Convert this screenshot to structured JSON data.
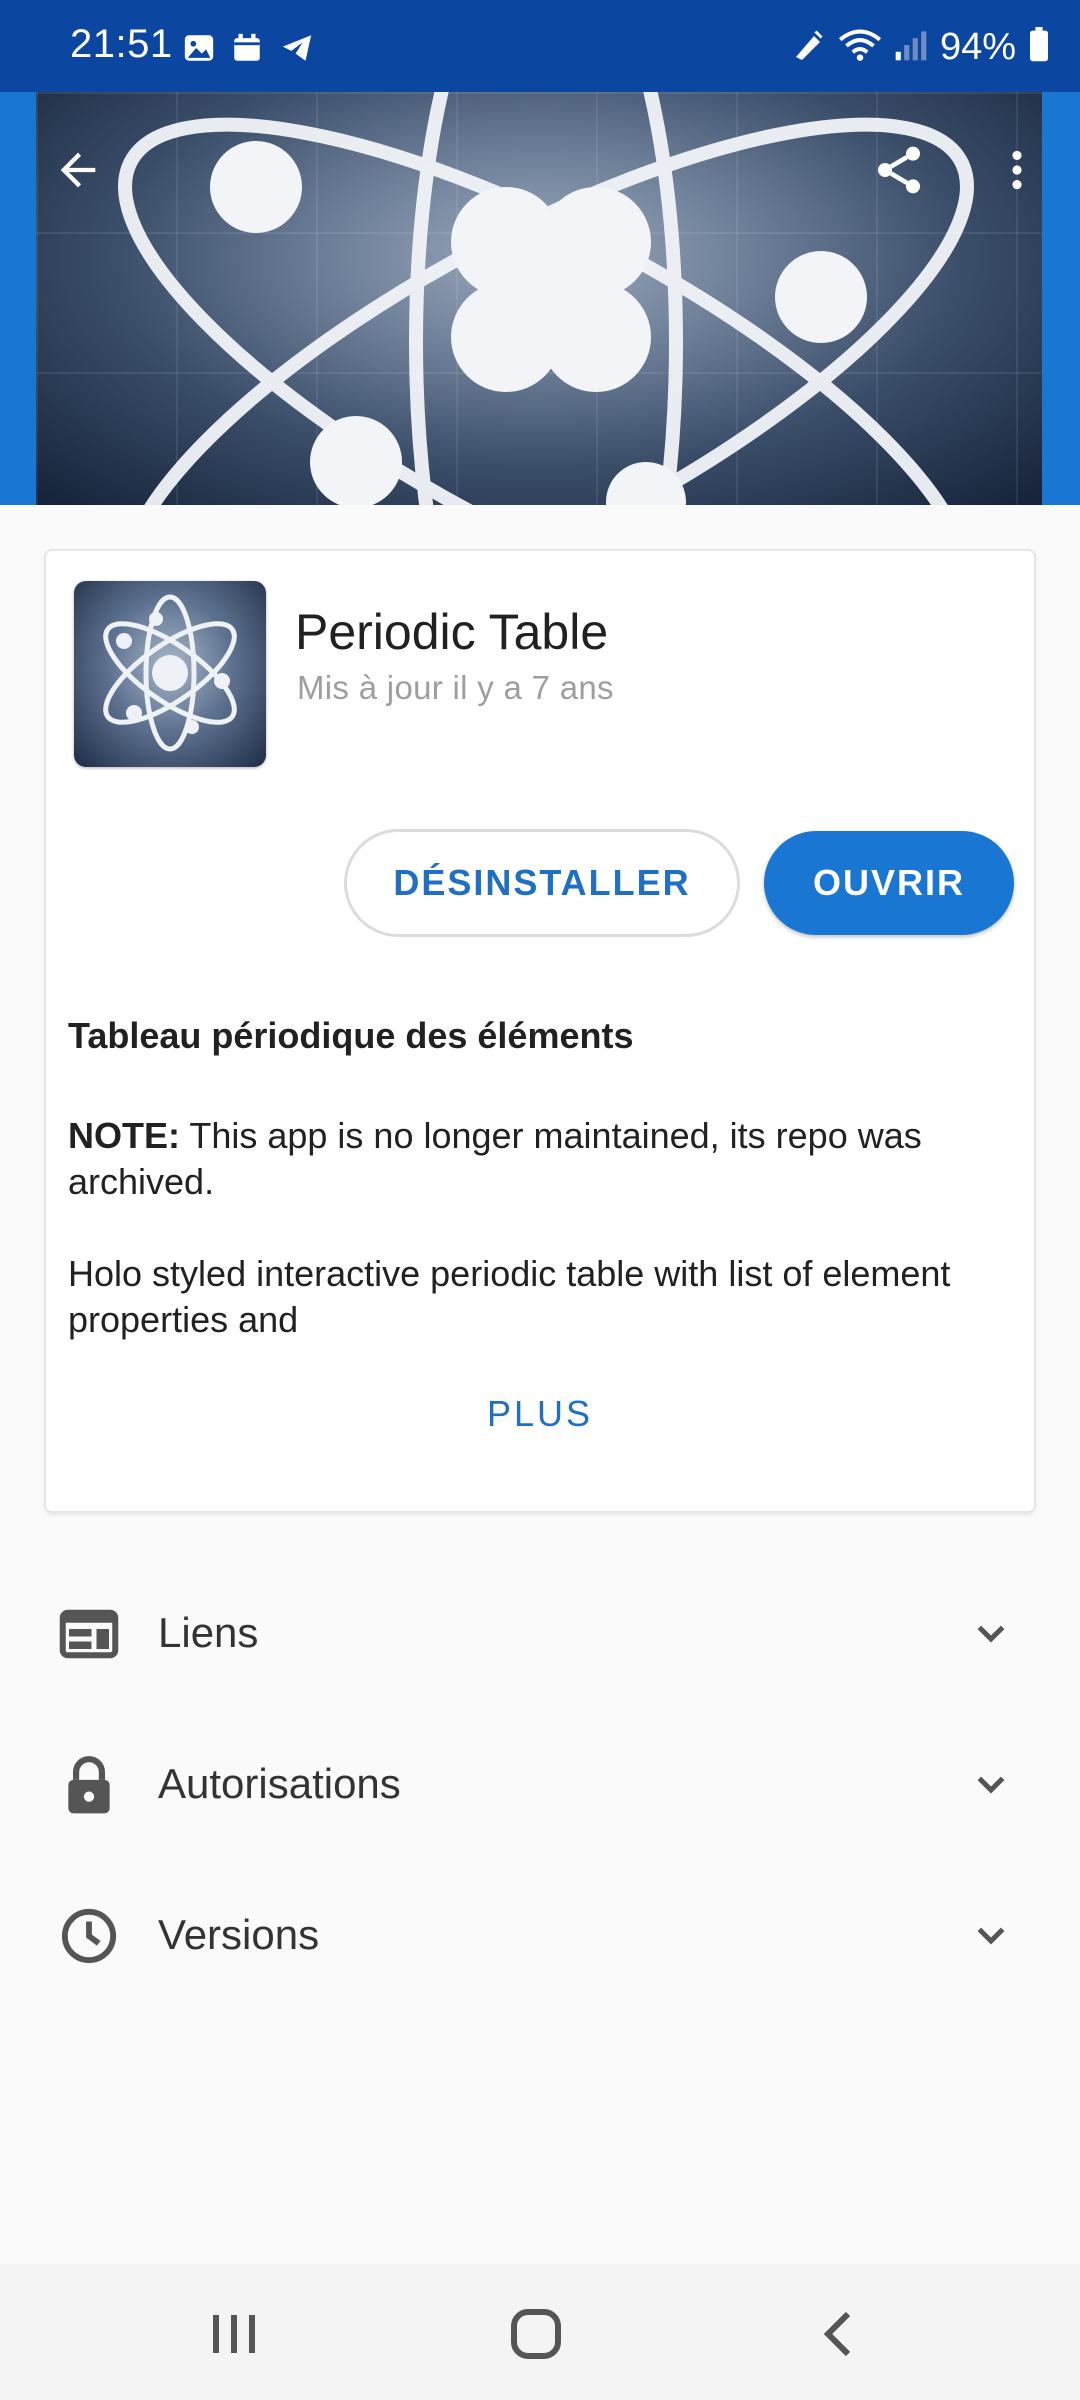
{
  "status_bar": {
    "time": "21:51",
    "battery": "94%",
    "left_icons": [
      "gallery-icon",
      "calendar-icon",
      "telegram-icon"
    ],
    "right_icons": [
      "nfc-icon",
      "wifi-icon",
      "signal-icon",
      "battery-icon"
    ]
  },
  "header": {
    "back_icon": "arrow-left-icon",
    "share_icon": "share-icon",
    "menu_icon": "more-vert-icon"
  },
  "app": {
    "title": "Periodic Table",
    "updated": "Mis à jour il y a 7 ans",
    "uninstall_label": "DÉSINSTALLER",
    "open_label": "OUVRIR",
    "description_heading": "Tableau périodique des éléments",
    "note_label": "NOTE:",
    "note_text": " This app is no longer maintained, its repo was archived.",
    "body_text": "Holo styled interactive periodic table with list of element properties and",
    "more_label": "PLUS"
  },
  "sections": [
    {
      "label": "Liens",
      "icon": "web-icon"
    },
    {
      "label": "Autorisations",
      "icon": "lock-icon"
    },
    {
      "label": "Versions",
      "icon": "clock-icon"
    }
  ],
  "colors": {
    "status_bar": "#0b47a1",
    "primary": "#1976d2",
    "accent_text": "#1f6fc5"
  }
}
